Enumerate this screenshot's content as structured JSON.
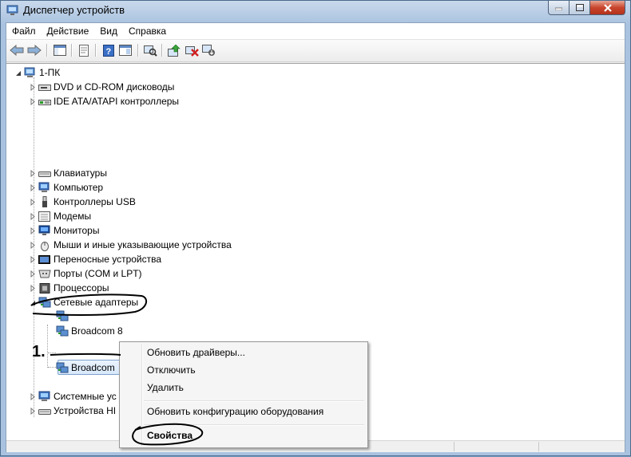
{
  "window": {
    "title": "Диспетчер устройств"
  },
  "menu": [
    "Файл",
    "Действие",
    "Вид",
    "Справка"
  ],
  "toolbar": {
    "buttons": [
      "back-icon",
      "forward-icon",
      "show-hide-tree-icon",
      "properties-icon",
      "help-icon",
      "view-icon",
      "scan-hardware-icon",
      "update-driver-icon",
      "uninstall-icon",
      "disable-icon"
    ]
  },
  "tree": {
    "root": "1-ПК",
    "categories_top": [
      {
        "label": "DVD и CD-ROM дисководы",
        "icon": "dvd-drive-icon"
      },
      {
        "label": "IDE ATA/ATAPI контроллеры",
        "icon": "ide-controller-icon"
      }
    ],
    "categories_mid": [
      {
        "label": "Клавиатуры",
        "icon": "keyboard-icon"
      },
      {
        "label": "Компьютер",
        "icon": "computer-icon"
      },
      {
        "label": "Контроллеры USB",
        "icon": "usb-icon"
      },
      {
        "label": "Модемы",
        "icon": "modem-icon"
      },
      {
        "label": "Мониторы",
        "icon": "monitor-icon"
      },
      {
        "label": "Мыши и иные указывающие устройства",
        "icon": "mouse-icon"
      },
      {
        "label": "Переносные устройства",
        "icon": "portable-device-icon"
      },
      {
        "label": "Порты (COM и LPT)",
        "icon": "port-icon"
      },
      {
        "label": "Процессоры",
        "icon": "processor-icon"
      }
    ],
    "network": {
      "label": "Сетевые адаптеры",
      "children": [
        "",
        "Broadcom 8",
        "Broadcom"
      ]
    },
    "categories_bottom": [
      {
        "label": "Системные ус",
        "icon": "system-device-icon"
      },
      {
        "label": "Устройства HI",
        "icon": "hid-icon"
      }
    ]
  },
  "context_menu": {
    "items": [
      "Обновить драйверы...",
      "Отключить",
      "Удалить",
      "Обновить конфигурацию оборудования",
      "Свойства"
    ]
  },
  "annotation": {
    "marker": "1."
  }
}
